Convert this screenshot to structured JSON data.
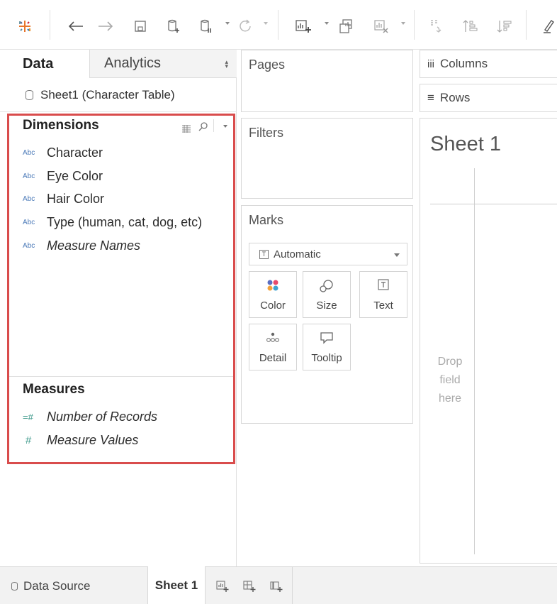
{
  "toolbar": {
    "icons": [
      "tableau-logo-icon",
      "back-arrow-icon",
      "forward-arrow-icon",
      "save-icon",
      "new-datasource-icon",
      "pause-updates-icon",
      "refresh-icon",
      "new-worksheet-icon",
      "duplicate-sheet-icon",
      "clear-sheet-icon",
      "swap-icon",
      "sort-ascending-icon",
      "sort-descending-icon",
      "highlight-icon"
    ]
  },
  "data_pane": {
    "tab_data": "Data",
    "tab_analytics": "Analytics",
    "datasource": "Sheet1 (Character Table)",
    "dimensions_title": "Dimensions",
    "dimensions": [
      {
        "type": "Abc",
        "label": "Character",
        "italic": false
      },
      {
        "type": "Abc",
        "label": "Eye Color",
        "italic": false
      },
      {
        "type": "Abc",
        "label": "Hair Color",
        "italic": false
      },
      {
        "type": "Abc",
        "label": "Type (human, cat, dog, etc)",
        "italic": false
      },
      {
        "type": "Abc",
        "label": "Measure Names",
        "italic": true
      }
    ],
    "measures_title": "Measures",
    "measures": [
      {
        "type": "=#",
        "label": "Number of Records",
        "italic": true
      },
      {
        "type": "#",
        "label": "Measure Values",
        "italic": true
      }
    ],
    "highlight_color": "#d94c4c"
  },
  "shelves": {
    "pages": "Pages",
    "filters": "Filters",
    "marks": "Marks",
    "marks_type": "Automatic",
    "mark_buttons": [
      "Color",
      "Size",
      "Text",
      "Detail",
      "Tooltip"
    ],
    "columns_icon": "iii",
    "columns": "Columns",
    "rows_icon": "≡",
    "rows": "Rows"
  },
  "canvas": {
    "sheet_title": "Sheet 1",
    "drop_line1": "Drop",
    "drop_line2": "field",
    "drop_line3": "here"
  },
  "bottom_bar": {
    "data_source": "Data Source",
    "sheet_tab": "Sheet 1"
  }
}
